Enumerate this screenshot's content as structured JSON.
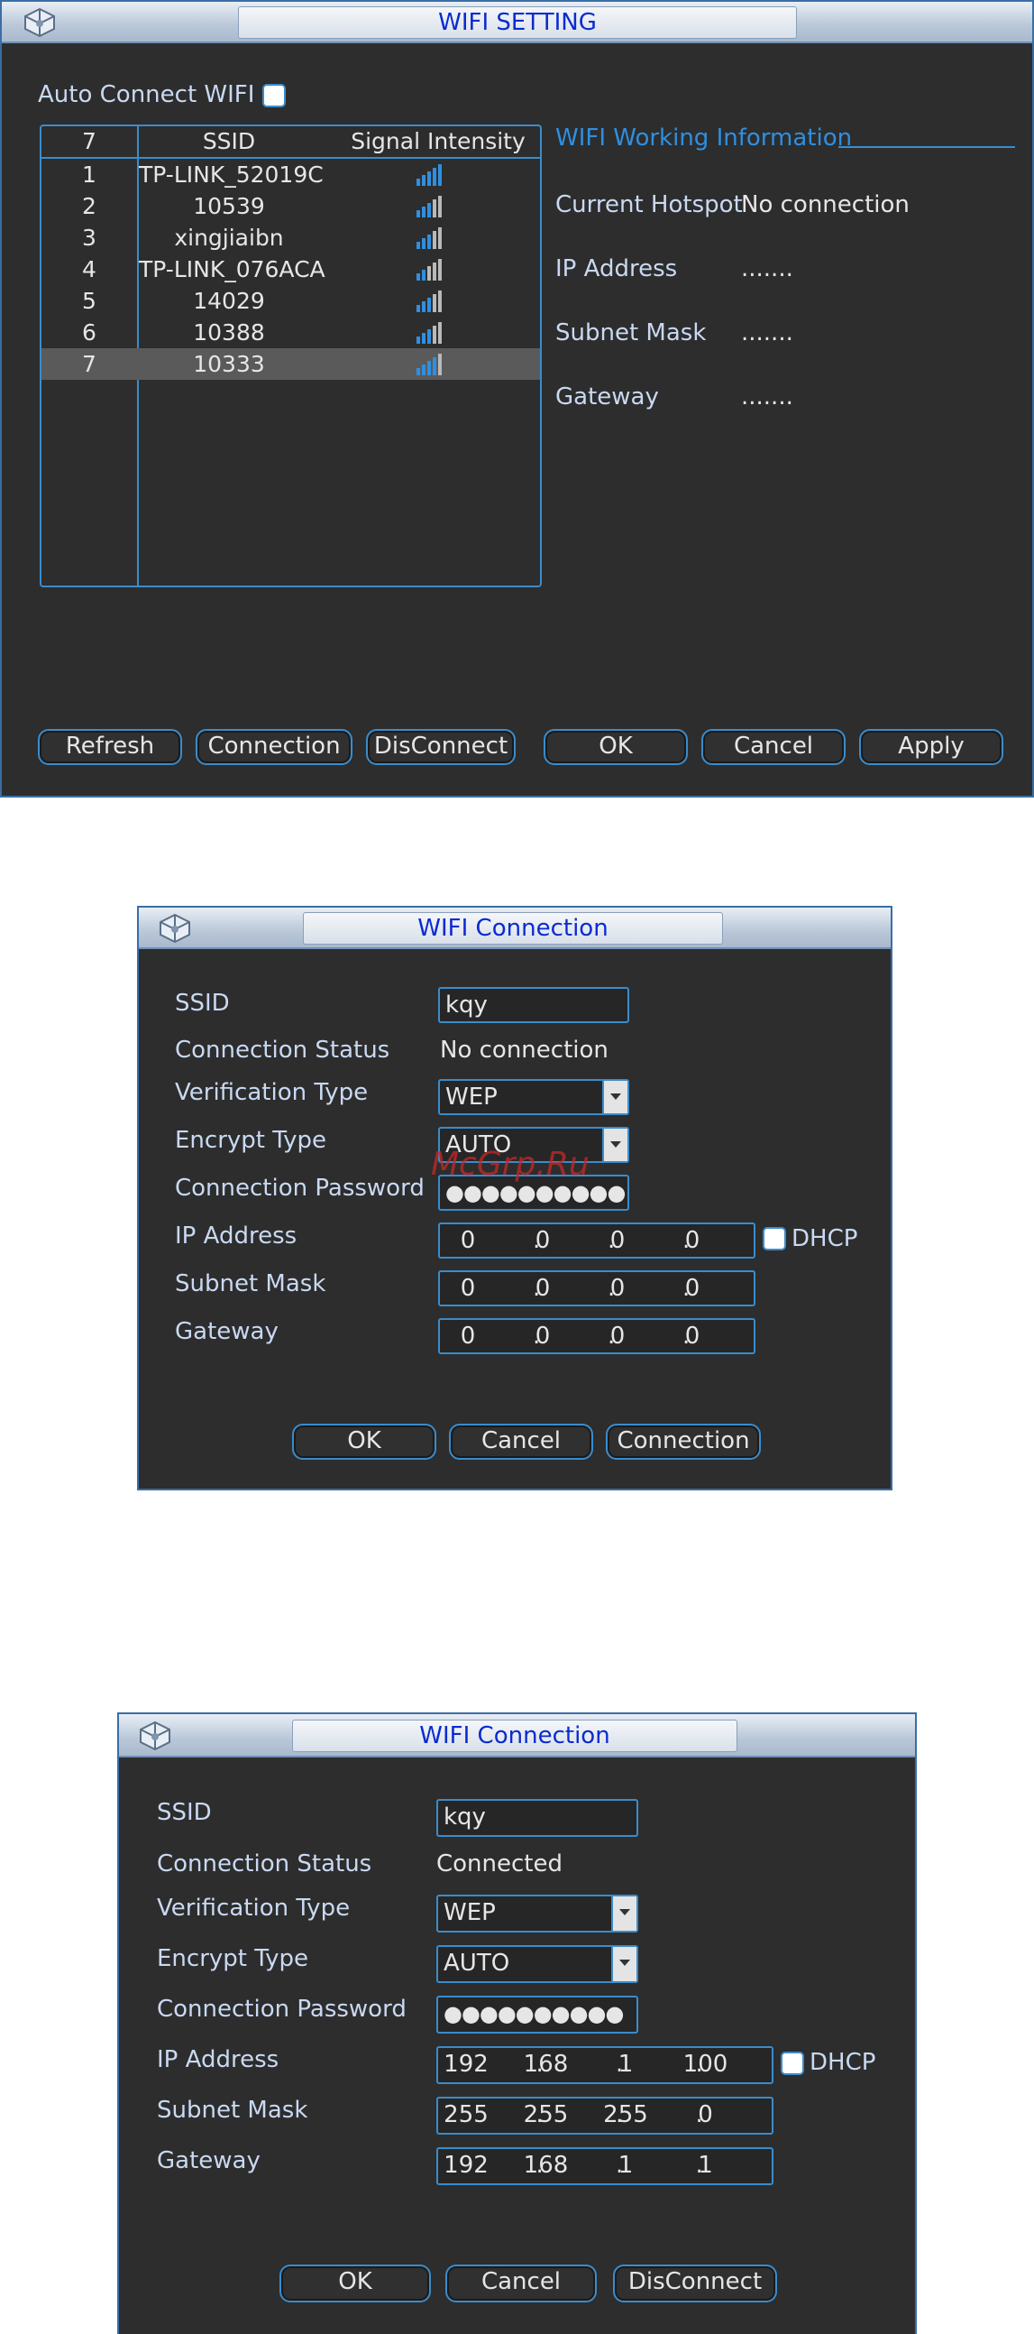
{
  "wifi_setting": {
    "title": "WIFI SETTING",
    "auto_connect_label": "Auto Connect WIFI",
    "list_header": {
      "count": "7",
      "ssid": "SSID",
      "signal": "Signal Intensity"
    },
    "networks": [
      {
        "index": "1",
        "ssid": "TP-LINK_52019C",
        "signal_level": 5
      },
      {
        "index": "2",
        "ssid": "10539",
        "signal_level": 3
      },
      {
        "index": "3",
        "ssid": "xingjiaibn",
        "signal_level": 3
      },
      {
        "index": "4",
        "ssid": "TP-LINK_076ACA",
        "signal_level": 2
      },
      {
        "index": "5",
        "ssid": "14029",
        "signal_level": 3
      },
      {
        "index": "6",
        "ssid": "10388",
        "signal_level": 3
      },
      {
        "index": "7",
        "ssid": "10333",
        "signal_level": 4,
        "selected": true
      }
    ],
    "info": {
      "heading": "WIFI Working Information",
      "current_hotspot_label": "Current Hotspot",
      "current_hotspot_value": "No connection",
      "ip_label": "IP Address",
      "ip_value": ".......",
      "subnet_label": "Subnet Mask",
      "subnet_value": ".......",
      "gateway_label": "Gateway",
      "gateway_value": "......."
    },
    "buttons": {
      "refresh": "Refresh",
      "connection": "Connection",
      "disconnect": "DisConnect",
      "ok": "OK",
      "cancel": "Cancel",
      "apply": "Apply"
    }
  },
  "wifi_connection_1": {
    "title": "WIFI Connection",
    "labels": {
      "ssid": "SSID",
      "status": "Connection Status",
      "verification": "Verification Type",
      "encrypt": "Encrypt Type",
      "password": "Connection Password",
      "ip": "IP Address",
      "subnet": "Subnet Mask",
      "gateway": "Gateway",
      "dhcp": "DHCP"
    },
    "ssid_value": "kqy",
    "status_value": "No connection",
    "verification_value": "WEP",
    "encrypt_value": "AUTO",
    "password_mask": "●●●●●●●●●●",
    "ip": [
      "0",
      "0",
      "0",
      "0"
    ],
    "subnet": [
      "0",
      "0",
      "0",
      "0"
    ],
    "gateway": [
      "0",
      "0",
      "0",
      "0"
    ],
    "buttons": {
      "ok": "OK",
      "cancel": "Cancel",
      "connection": "Connection"
    }
  },
  "watermark": "McGrp.Ru",
  "wifi_connection_2": {
    "title": "WIFI Connection",
    "labels": {
      "ssid": "SSID",
      "status": "Connection Status",
      "verification": "Verification Type",
      "encrypt": "Encrypt Type",
      "password": "Connection Password",
      "ip": "IP Address",
      "subnet": "Subnet Mask",
      "gateway": "Gateway",
      "dhcp": "DHCP"
    },
    "ssid_value": "kqy",
    "status_value": "Connected",
    "verification_value": "WEP",
    "encrypt_value": "AUTO",
    "password_mask": "●●●●●●●●●●",
    "ip": [
      "192",
      "168",
      "1",
      "100"
    ],
    "subnet": [
      "255",
      "255",
      "255",
      "0"
    ],
    "gateway": [
      "192",
      "168",
      "1",
      "1"
    ],
    "buttons": {
      "ok": "OK",
      "cancel": "Cancel",
      "disconnect": "DisConnect"
    }
  },
  "colors": {
    "accent": "#3a8ccc",
    "title_text": "#0a2bd0",
    "window_bg": "#2d2d2d",
    "selected_row": "#5a5a5a",
    "signal_on": "#2f8fe0",
    "signal_off": "#b9b9b9"
  }
}
